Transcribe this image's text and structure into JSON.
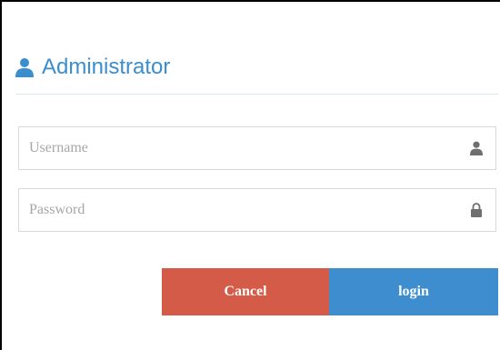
{
  "header": {
    "title": "Administrator",
    "icon": "user-icon",
    "color": "#3a8ecd"
  },
  "form": {
    "username": {
      "value": "",
      "placeholder": "Username",
      "icon": "user-icon"
    },
    "password": {
      "value": "",
      "placeholder": "Password",
      "icon": "lock-icon"
    }
  },
  "buttons": {
    "cancel_label": "Cancel",
    "cancel_color": "#d35b47",
    "login_label": "login",
    "login_color": "#3e8ecf"
  }
}
